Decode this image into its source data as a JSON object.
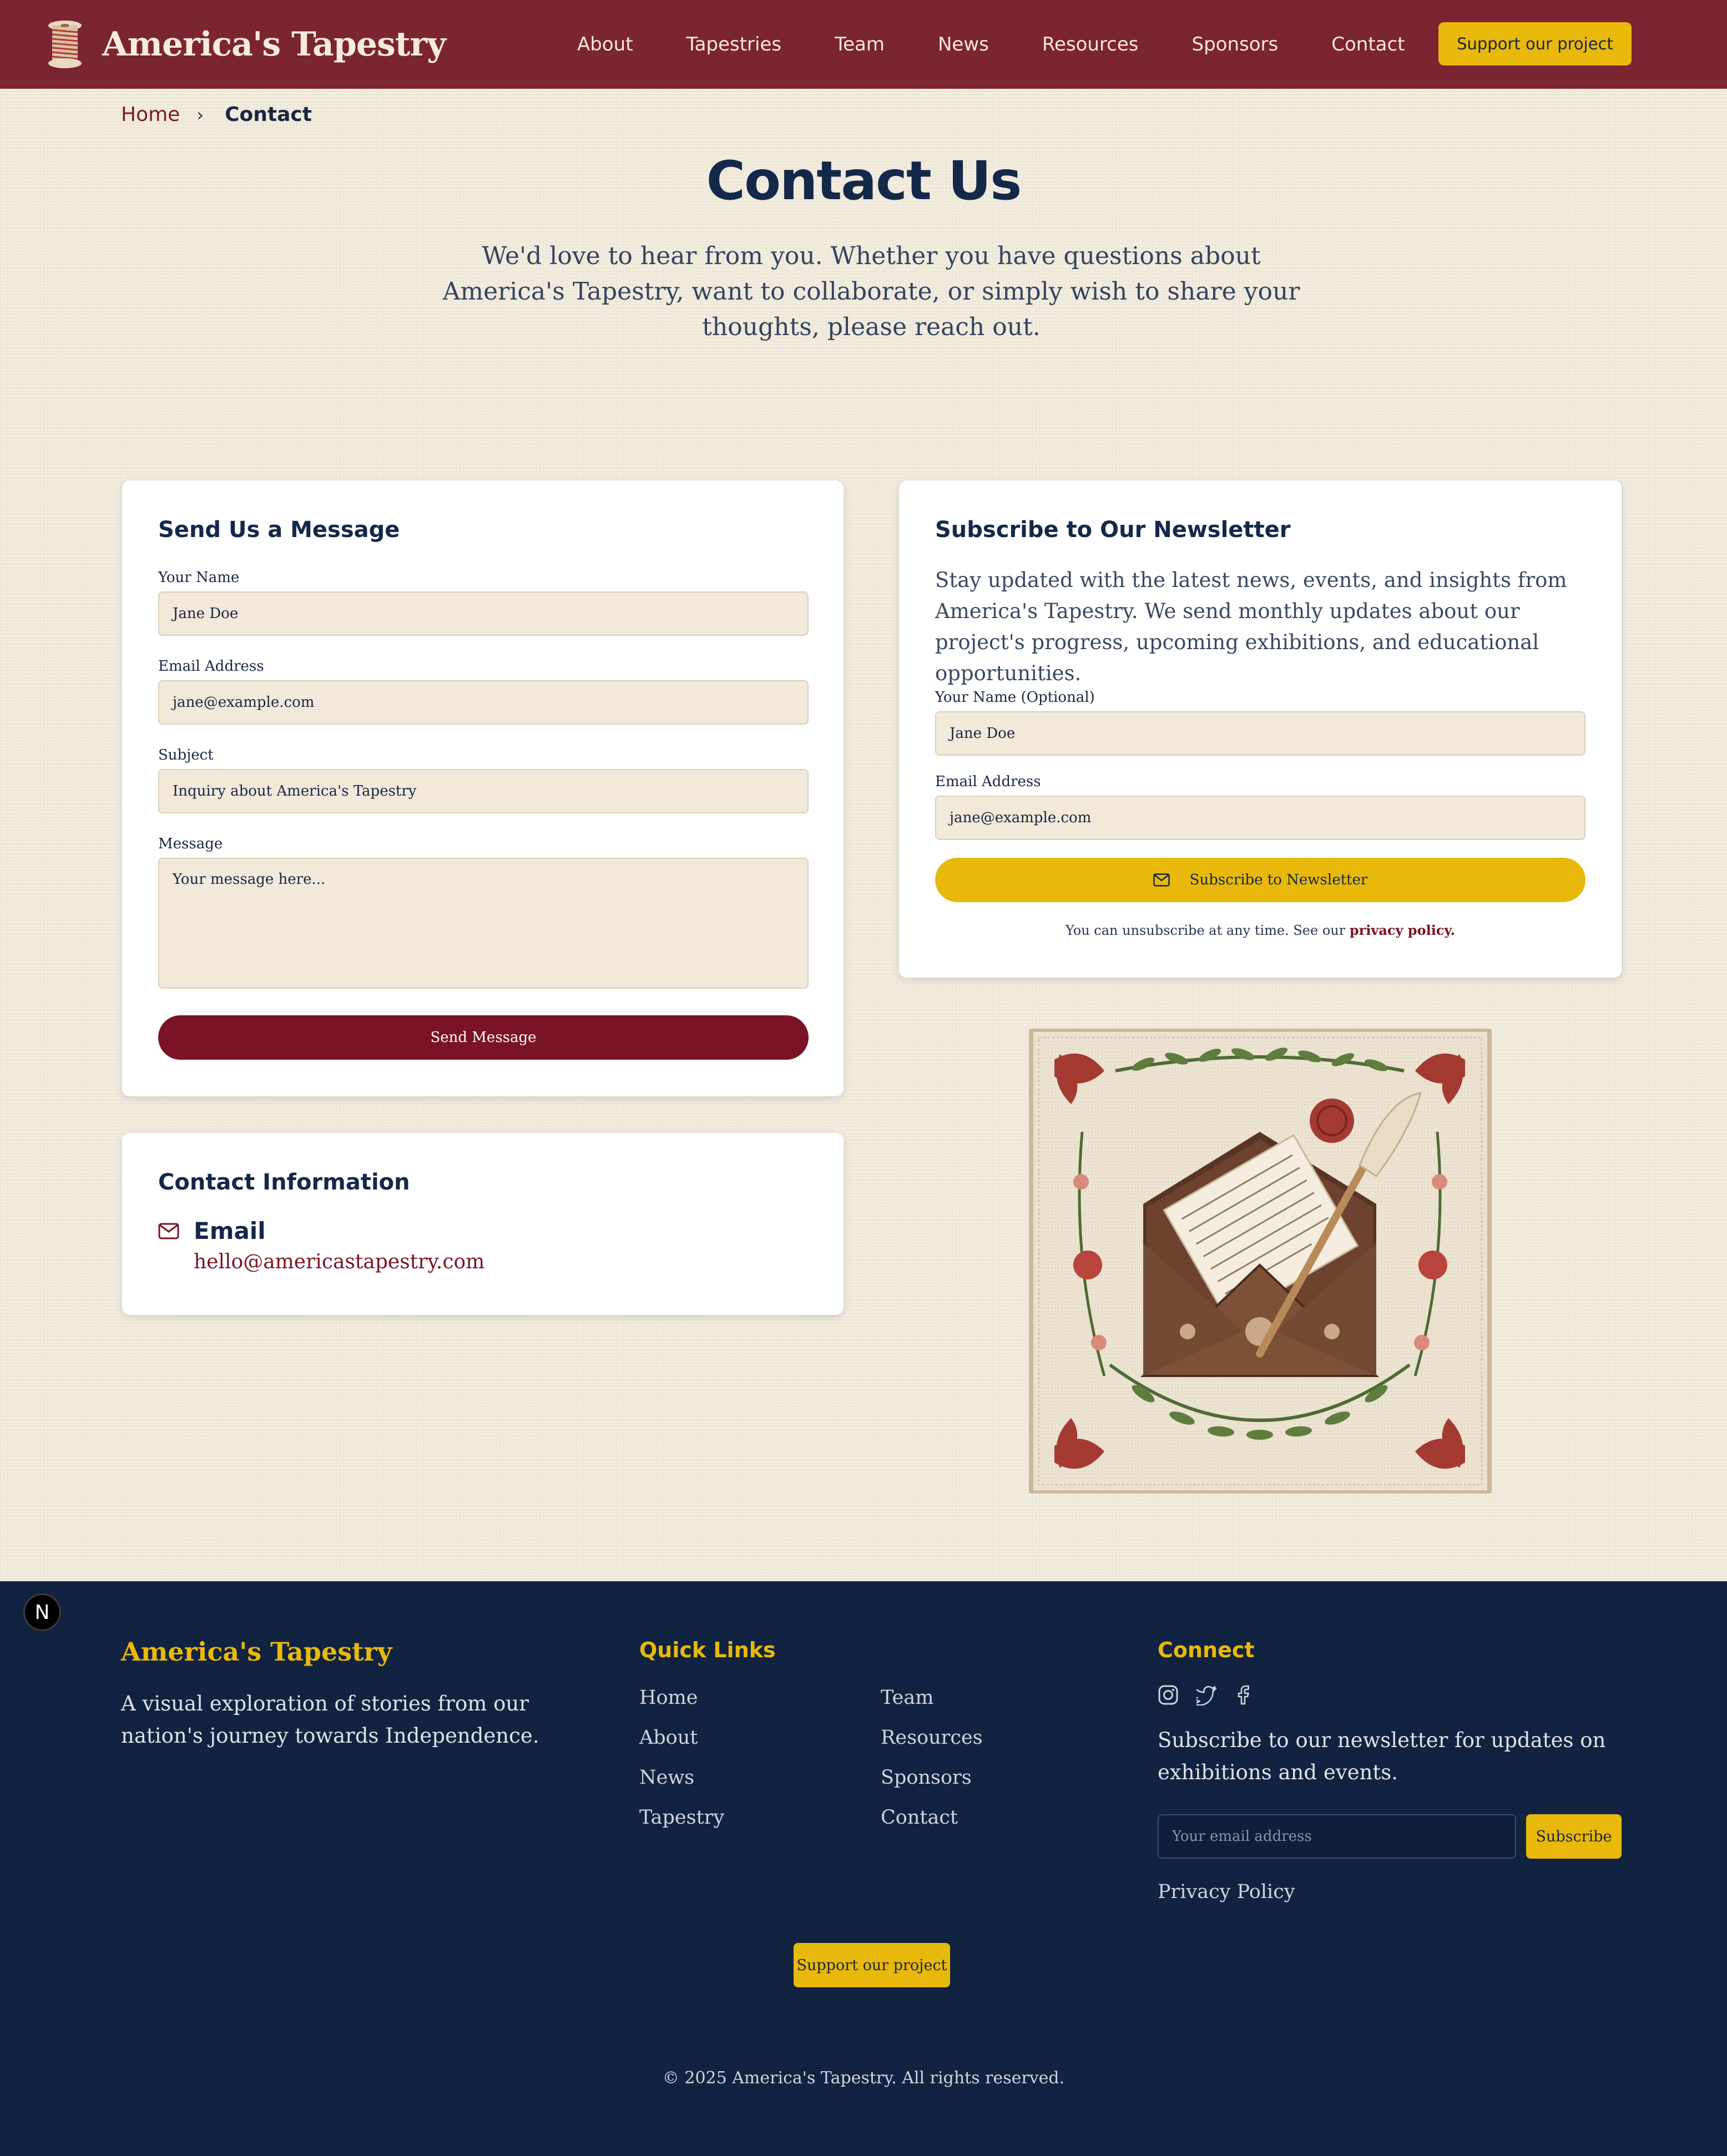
{
  "header": {
    "brand": "America's Tapestry",
    "nav": [
      "About",
      "Tapestries",
      "Team",
      "News",
      "Resources",
      "Sponsors",
      "Contact"
    ],
    "cta": "Support our project"
  },
  "breadcrumb": {
    "home": "Home",
    "separator": "›",
    "current": "Contact"
  },
  "page": {
    "title": "Contact Us",
    "intro": "We'd love to hear from you. Whether you have questions about America's Tapestry, want to collaborate, or simply wish to share your thoughts, please reach out."
  },
  "message_form": {
    "title": "Send Us a Message",
    "name_label": "Your Name",
    "name_placeholder": "Jane Doe",
    "email_label": "Email Address",
    "email_placeholder": "jane@example.com",
    "subject_label": "Subject",
    "subject_placeholder": "Inquiry about America's Tapestry",
    "message_label": "Message",
    "message_placeholder": "Your message here...",
    "submit": "Send Message"
  },
  "contact_info": {
    "title": "Contact Information",
    "email_heading": "Email",
    "email": "hello@americastapestry.com"
  },
  "newsletter": {
    "title": "Subscribe to Our Newsletter",
    "description": "Stay updated with the latest news, events, and insights from America's Tapestry. We send monthly updates about our project's progress, upcoming exhibitions, and educational opportunities.",
    "name_label": "Your Name (Optional)",
    "name_placeholder": "Jane Doe",
    "email_label": "Email Address",
    "email_placeholder": "jane@example.com",
    "submit": "Subscribe to Newsletter",
    "fine_print": "You can unsubscribe at any time. See our ",
    "privacy_link": "privacy policy."
  },
  "footer": {
    "brand": "America's Tapestry",
    "description": "A visual exploration of stories from our nation's journey towards Independence.",
    "quick_links_title": "Quick Links",
    "links_col1": [
      "Home",
      "About",
      "News",
      "Tapestry"
    ],
    "links_col2": [
      "Team",
      "Resources",
      "Sponsors",
      "Contact"
    ],
    "connect_title": "Connect",
    "social_icons": [
      "instagram-icon",
      "twitter-icon",
      "facebook-icon"
    ],
    "connect_text": "Subscribe to our newsletter for updates on exhibitions and events.",
    "email_placeholder": "Your email address",
    "subscribe": "Subscribe",
    "privacy": "Privacy Policy",
    "cta": "Support our project",
    "copyright": "© 2025 America's Tapestry. All rights reserved."
  },
  "dev_badge": "N",
  "colors": {
    "header_bg": "#7b2432",
    "accent_gold": "#e8b90b",
    "primary_button": "#7a1325",
    "footer_bg": "#122341",
    "page_bg": "#f3ede0"
  }
}
